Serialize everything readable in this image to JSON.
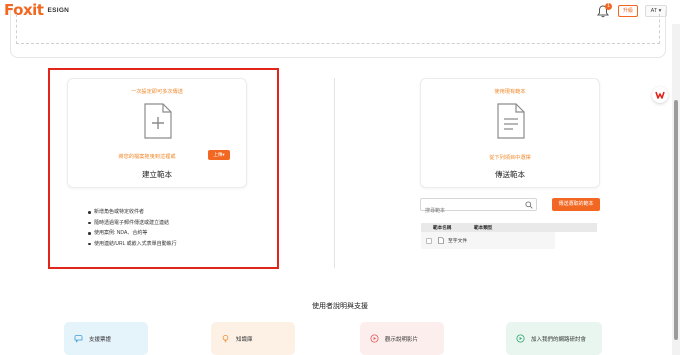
{
  "header": {
    "logo_text": "Foxit",
    "logo_sub": "ESIGN",
    "notification_count": "1",
    "upgrade_label": "升級",
    "user_initials": "AT",
    "icons": {
      "bell": "bell-icon",
      "caret": "chevron-down-icon"
    }
  },
  "create_template": {
    "top_hint": "一次設定即可多次傳送",
    "drag_hint": "將您的檔案拖曳到這裡或",
    "upload_label": "上傳",
    "title": "建立範本",
    "features": [
      "新增角色或特定收件者",
      "隨時透過電子郵件傳送或建立連結",
      "使用案例: NDA、合約等",
      "使用連結/URL 或嵌入式表單自動執行"
    ]
  },
  "send_template": {
    "top_hint": "使用現有範本",
    "select_hint": "從下列項目中選擇",
    "title": "傳送範本",
    "search_placeholder": "搜尋範本",
    "send_button": "傳送選取的範本",
    "table": {
      "headers": [
        "範本名稱",
        "範本類型"
      ],
      "rows": [
        {
          "name": "",
          "type": "至字文件"
        }
      ]
    }
  },
  "support": {
    "title": "使用者說明與支援",
    "cards": [
      {
        "label": "支援票證",
        "icon": "chat-icon",
        "color": "#3a9ad9"
      },
      {
        "label": "知識庫",
        "icon": "lightbulb-icon",
        "color": "#f0892b"
      },
      {
        "label": "觀示說明影片",
        "icon": "video-icon",
        "color": "#e05a5a"
      },
      {
        "label": "加入我們的網路研討會",
        "icon": "play-circle-icon",
        "color": "#2fa56b"
      }
    ]
  },
  "colors": {
    "accent": "#f26722",
    "highlight_frame": "#e1251b"
  }
}
